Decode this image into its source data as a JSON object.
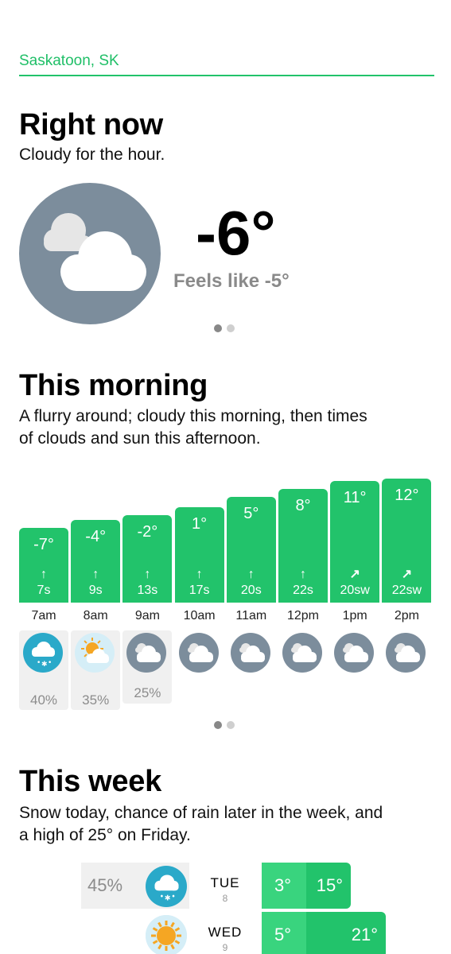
{
  "location": "Saskatoon, SK",
  "now": {
    "title": "Right now",
    "summary": "Cloudy for the hour.",
    "temp": "-6°",
    "feels": "Feels like -5°",
    "icon": "cloudy-icon"
  },
  "morning": {
    "title": "This morning",
    "summary_line1": "A flurry around; cloudy this morning, then times",
    "summary_line2": "of clouds and sun this afternoon.",
    "hours": [
      {
        "time": "7am",
        "temp": "-7°",
        "temp_value": -7,
        "arrow": "↑",
        "wind": "7s",
        "icon": "snow-cloud-icon",
        "precip": "40%"
      },
      {
        "time": "8am",
        "temp": "-4°",
        "temp_value": -4,
        "arrow": "↑",
        "wind": "9s",
        "icon": "partly-sunny-icon",
        "precip": "35%"
      },
      {
        "time": "9am",
        "temp": "-2°",
        "temp_value": -2,
        "arrow": "↑",
        "wind": "13s",
        "icon": "cloudy-icon",
        "precip": "25%"
      },
      {
        "time": "10am",
        "temp": "1°",
        "temp_value": 1,
        "arrow": "↑",
        "wind": "17s",
        "icon": "cloudy-icon",
        "precip": ""
      },
      {
        "time": "11am",
        "temp": "5°",
        "temp_value": 5,
        "arrow": "↑",
        "wind": "20s",
        "icon": "cloudy-icon",
        "precip": ""
      },
      {
        "time": "12pm",
        "temp": "8°",
        "temp_value": 8,
        "arrow": "↑",
        "wind": "22s",
        "icon": "cloudy-icon",
        "precip": ""
      },
      {
        "time": "1pm",
        "temp": "11°",
        "temp_value": 11,
        "arrow": "↗",
        "wind": "20sw",
        "icon": "cloudy-icon",
        "precip": ""
      },
      {
        "time": "2pm",
        "temp": "12°",
        "temp_value": 12,
        "arrow": "↗",
        "wind": "22sw",
        "icon": "cloudy-icon",
        "precip": ""
      }
    ]
  },
  "week": {
    "title": "This week",
    "summary_line1": "Snow today, chance of rain later in the week, and",
    "summary_line2": "a high of 25° on Friday.",
    "days": [
      {
        "name": "TUE",
        "date": "8",
        "precip": "45%",
        "icon": "snow-cloud-icon",
        "low": "3°",
        "high": "15°",
        "high_value": 15
      },
      {
        "name": "WED",
        "date": "9",
        "precip": "",
        "icon": "sun-icon",
        "low": "5°",
        "high": "21°",
        "high_value": 21
      }
    ]
  },
  "colors": {
    "accent": "#22c36b",
    "cloud_bg": "#7c8d9c",
    "snow_bg": "#2aa9c9",
    "sun": "#f5a623"
  }
}
